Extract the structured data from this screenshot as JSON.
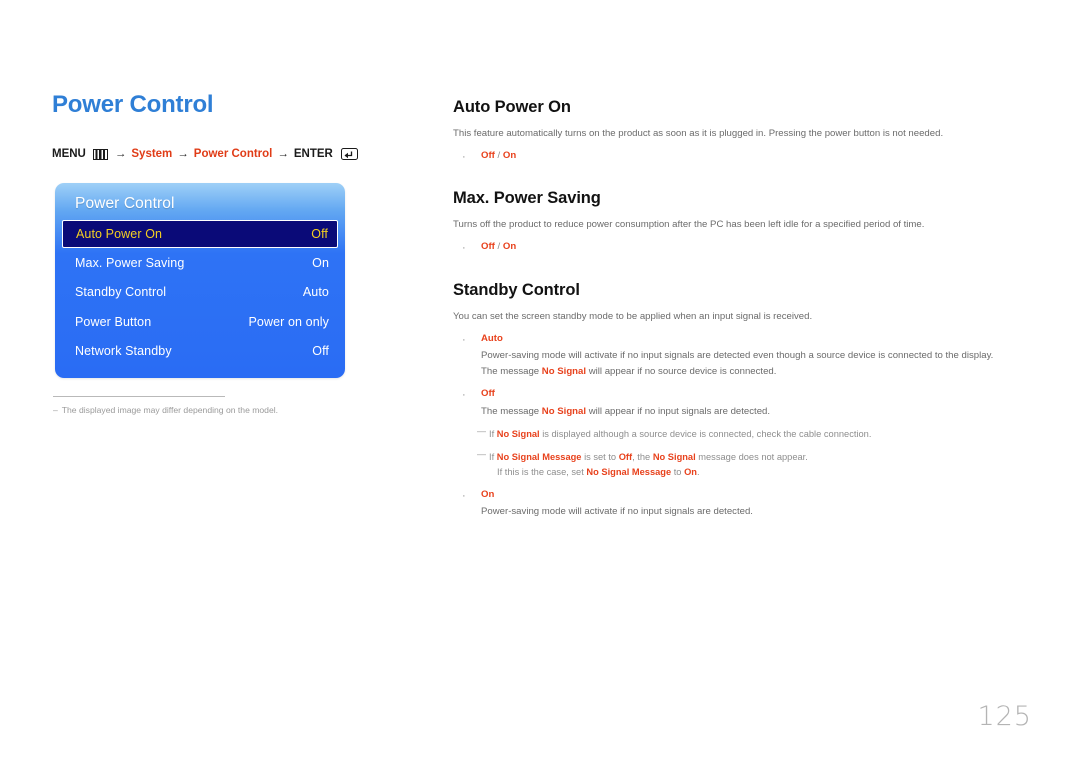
{
  "page": {
    "title": "Power Control",
    "number": "125"
  },
  "breadcrumb": {
    "menu_label": "MENU",
    "menu_icon": "menu-bars-icon",
    "arrow": "→",
    "step1": "System",
    "step2": "Power Control",
    "enter_label": "ENTER",
    "enter_icon": "enter-key-icon"
  },
  "osd": {
    "title": "Power Control",
    "rows": [
      {
        "label": "Auto Power On",
        "value": "Off",
        "selected": true
      },
      {
        "label": "Max. Power Saving",
        "value": "On",
        "selected": false
      },
      {
        "label": "Standby Control",
        "value": "Auto",
        "selected": false
      },
      {
        "label": "Power Button",
        "value": "Power on only",
        "selected": false
      },
      {
        "label": "Network Standby",
        "value": "Off",
        "selected": false
      }
    ]
  },
  "footnote": {
    "dash": "–",
    "text": "The displayed image may differ depending on the model."
  },
  "sections": {
    "auto_power_on": {
      "title": "Auto Power On",
      "body": "This feature automatically turns on the product as soon as it is plugged in. Pressing the power button is not needed.",
      "bullet_dot": "·",
      "option_off": "Off",
      "option_slash": " / ",
      "option_on": "On"
    },
    "max_power_saving": {
      "title": "Max. Power Saving",
      "body": "Turns off the product to reduce power consumption after the PC has been left idle for a specified period of time.",
      "bullet_dot": "·",
      "option_off": "Off",
      "option_slash": " / ",
      "option_on": "On"
    },
    "standby_control": {
      "title": "Standby Control",
      "body": "You can set the screen standby mode to be applied when an input signal is received.",
      "bullet_dot": "·",
      "auto": {
        "label": "Auto",
        "line1": "Power-saving mode will activate if no input signals are detected even though a source device is connected to the display.",
        "line2_pre": "The message ",
        "line2_em": "No Signal",
        "line2_post": " will appear if no source device is connected."
      },
      "off": {
        "label": "Off",
        "line1_pre": "The message ",
        "line1_em": "No Signal",
        "line1_post": " will appear if no input signals are detected."
      },
      "notes": [
        {
          "dash": "—",
          "pre": "If ",
          "em1": "No Signal",
          "mid1": " is displayed although a source device is connected, check the cable connection."
        },
        {
          "dash": "—",
          "pre": "If ",
          "em1": "No Signal Message",
          "mid1": " is set to ",
          "em2": "Off",
          "mid2": ", the ",
          "em3": "No Signal",
          "mid3": " message does not appear.",
          "cont_pre": "If this is the case, set ",
          "cont_em": "No Signal Message",
          "cont_mid": " to ",
          "cont_em2": "On",
          "cont_post": "."
        }
      ],
      "on": {
        "label": "On",
        "line1": "Power-saving mode will activate if no input signals are detected."
      }
    }
  }
}
